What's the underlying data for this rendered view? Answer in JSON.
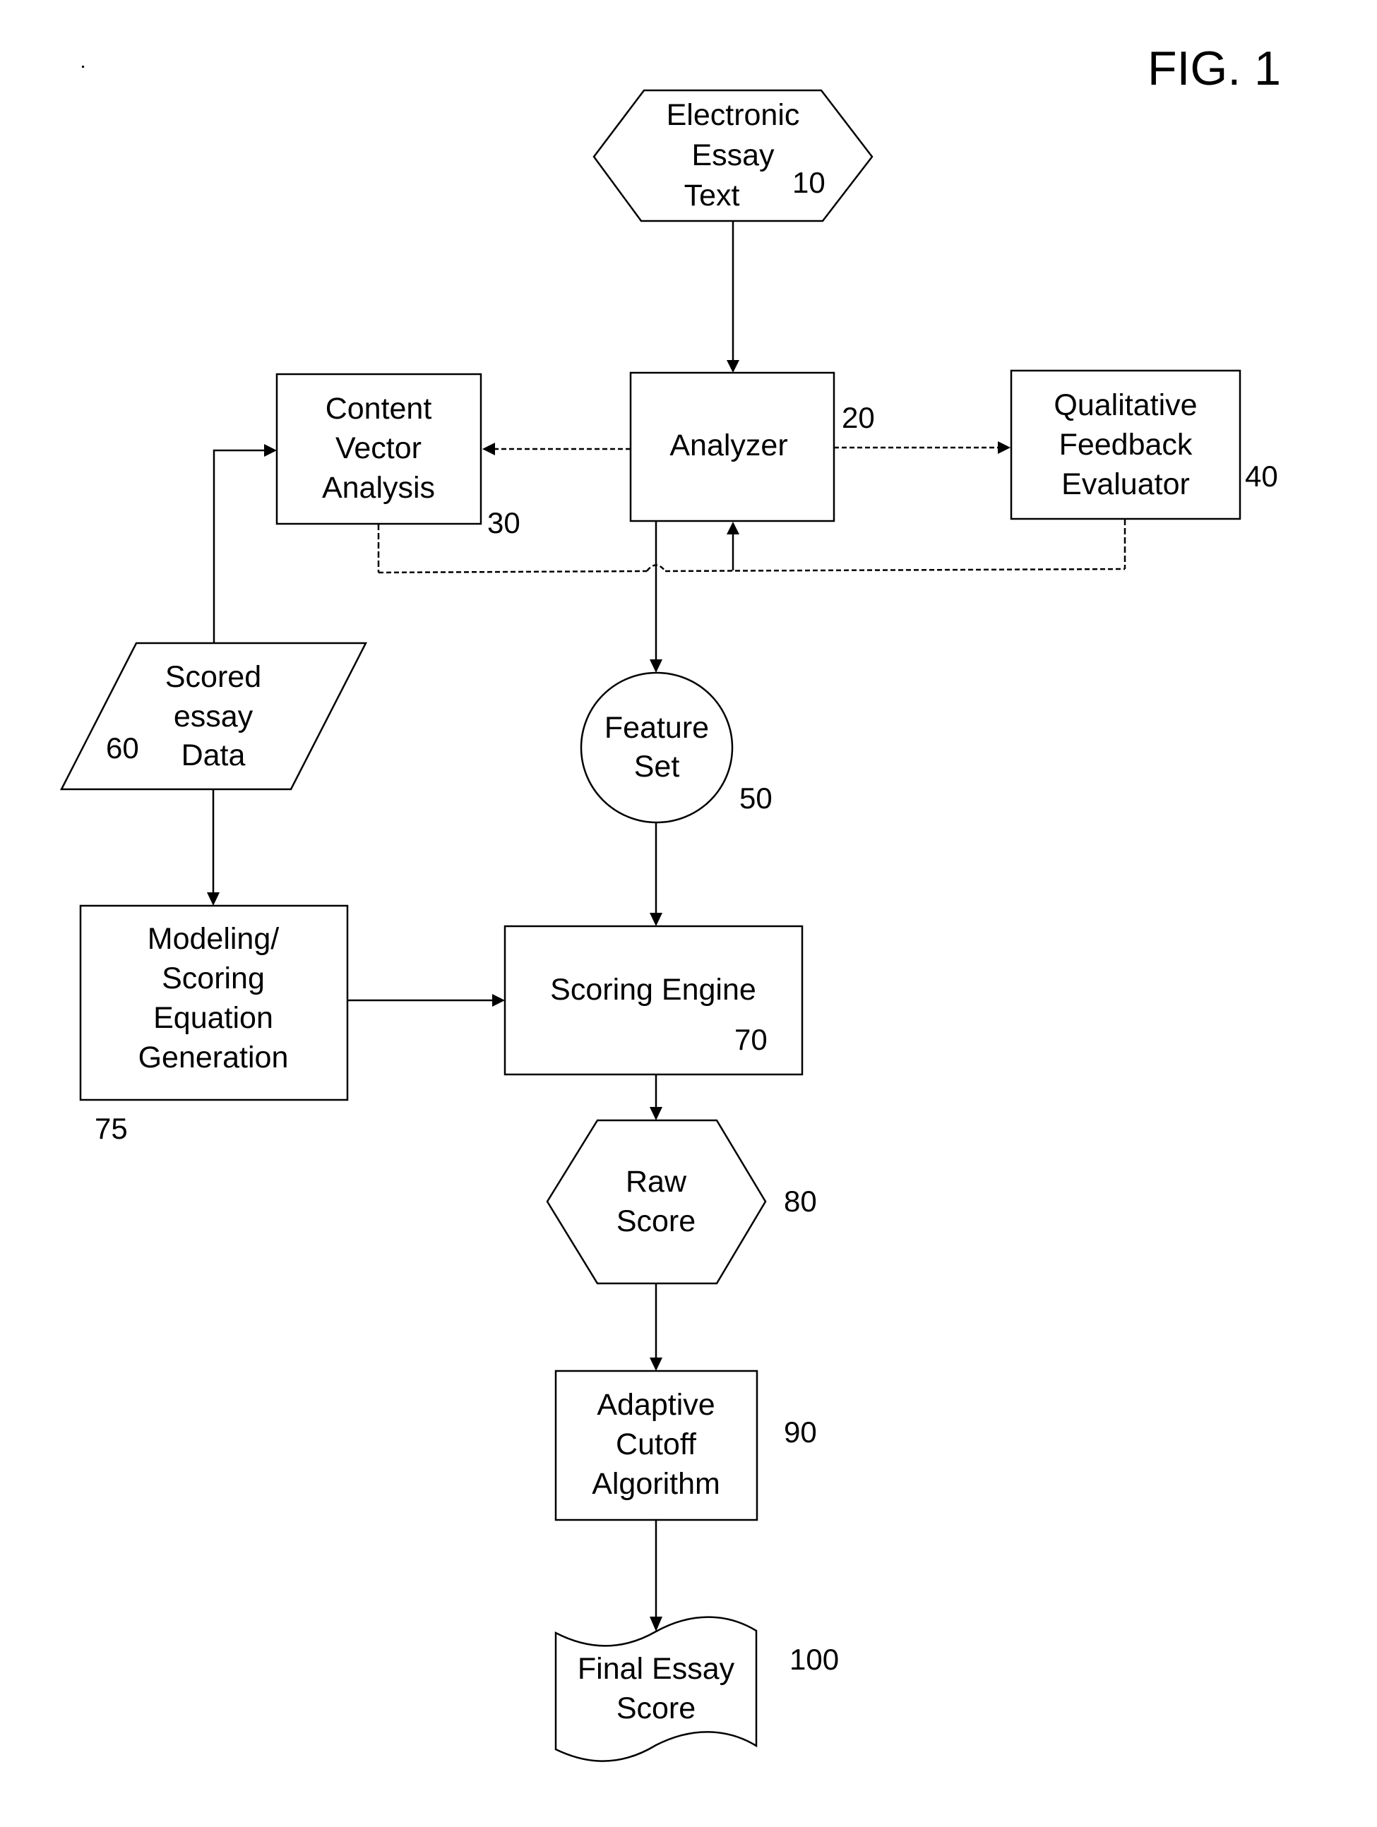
{
  "figure": {
    "title": "FIG. 1"
  },
  "nodes": {
    "essay_text": {
      "lines": [
        "Electronic",
        "Essay",
        "Text"
      ],
      "ref": "10",
      "shape": "hexagon"
    },
    "analyzer": {
      "lines": [
        "Analyzer"
      ],
      "ref": "20",
      "shape": "rectangle"
    },
    "content_vector": {
      "lines": [
        "Content",
        "Vector",
        "Analysis"
      ],
      "ref": "30",
      "shape": "rectangle"
    },
    "qualitative": {
      "lines": [
        "Qualitative",
        "Feedback",
        "Evaluator"
      ],
      "ref": "40",
      "shape": "rectangle"
    },
    "feature_set": {
      "lines": [
        "Feature",
        "Set"
      ],
      "ref": "50",
      "shape": "circle"
    },
    "scored_essay": {
      "lines": [
        "Scored",
        "essay",
        "Data"
      ],
      "ref": "60",
      "shape": "parallelogram"
    },
    "scoring_engine": {
      "lines": [
        "Scoring Engine"
      ],
      "ref": "70",
      "shape": "rectangle"
    },
    "modeling": {
      "lines": [
        "Modeling/",
        "Scoring",
        "Equation",
        "Generation"
      ],
      "ref": "75",
      "shape": "rectangle"
    },
    "raw_score": {
      "lines": [
        "Raw",
        "Score"
      ],
      "ref": "80",
      "shape": "hexagon"
    },
    "adaptive_cutoff": {
      "lines": [
        "Adaptive",
        "Cutoff",
        "Algorithm"
      ],
      "ref": "90",
      "shape": "rectangle"
    },
    "final_score": {
      "lines": [
        "Final Essay",
        "Score"
      ],
      "ref": "100",
      "shape": "document"
    }
  },
  "edges": [
    {
      "from": "essay_text",
      "to": "analyzer",
      "style": "solid"
    },
    {
      "from": "analyzer",
      "to": "content_vector",
      "style": "dashed"
    },
    {
      "from": "analyzer",
      "to": "qualitative",
      "style": "dashed"
    },
    {
      "from": "content_vector",
      "to": "analyzer",
      "style": "dashed",
      "note": "feedback loop merges into solid arrow up"
    },
    {
      "from": "qualitative",
      "to": "analyzer",
      "style": "dashed",
      "note": "feedback loop merges into solid arrow up"
    },
    {
      "from": "analyzer",
      "to": "feature_set",
      "style": "solid"
    },
    {
      "from": "scored_essay",
      "to": "content_vector",
      "style": "solid"
    },
    {
      "from": "scored_essay",
      "to": "modeling",
      "style": "solid"
    },
    {
      "from": "feature_set",
      "to": "scoring_engine",
      "style": "solid"
    },
    {
      "from": "modeling",
      "to": "scoring_engine",
      "style": "solid"
    },
    {
      "from": "scoring_engine",
      "to": "raw_score",
      "style": "solid"
    },
    {
      "from": "raw_score",
      "to": "adaptive_cutoff",
      "style": "solid"
    },
    {
      "from": "adaptive_cutoff",
      "to": "final_score",
      "style": "solid"
    }
  ]
}
